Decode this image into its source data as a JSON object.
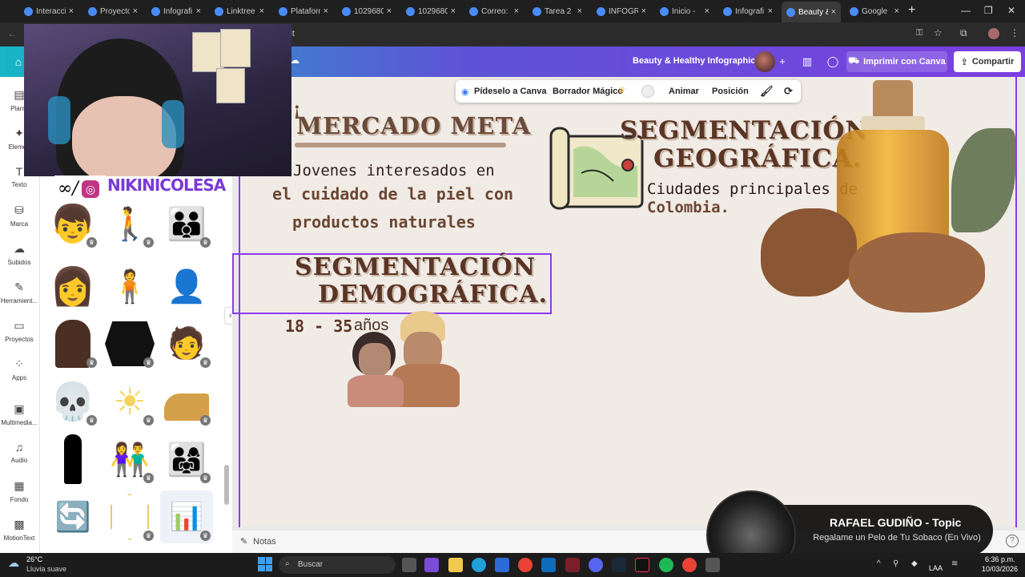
{
  "browser": {
    "tabs": [
      {
        "label": "Interacci"
      },
      {
        "label": "Proyecto"
      },
      {
        "label": "Infografi"
      },
      {
        "label": "Linktree"
      },
      {
        "label": "Plataform"
      },
      {
        "label": "1029680"
      },
      {
        "label": "1029680"
      },
      {
        "label": "Correo: "
      },
      {
        "label": "Tarea 2"
      },
      {
        "label": "INFOGR"
      },
      {
        "label": "Inicio - "
      },
      {
        "label": "Infografi"
      },
      {
        "label": "Beauty &"
      },
      {
        "label": "Google"
      }
    ],
    "url_fragment": "lit"
  },
  "canva_header": {
    "doc_title": "Beauty & Healthy Infographic",
    "print_label": "Imprimir con Canva",
    "share_label": "Compartir"
  },
  "left_rail": {
    "items": [
      {
        "label": "Plantil",
        "icon": "template-icon"
      },
      {
        "label": "Elemen",
        "icon": "elements-icon"
      },
      {
        "label": "Texto",
        "icon": "text-icon"
      },
      {
        "label": "Marca",
        "icon": "brand-icon"
      },
      {
        "label": "Subidos",
        "icon": "upload-icon"
      },
      {
        "label": "Herramient...",
        "icon": "tools-icon"
      },
      {
        "label": "Proyectos",
        "icon": "folder-icon"
      },
      {
        "label": "Apps",
        "icon": "apps-icon"
      },
      {
        "label": "Multimedia...",
        "icon": "media-icon"
      },
      {
        "label": "Audio",
        "icon": "audio-icon"
      },
      {
        "label": "Fondo",
        "icon": "background-icon"
      },
      {
        "label": "MotionText",
        "icon": "motiontext-icon"
      }
    ]
  },
  "floating_toolbar": {
    "ask_canva": "Pídeselo a Canva",
    "magic_eraser": "Borrador Mágico",
    "animate": "Animar",
    "position": "Posición"
  },
  "design": {
    "mercado_meta": "MERCADO META",
    "target_line1": "Jovenes interesados en",
    "target_line2": "el cuidado de la piel con",
    "target_line3": "productos naturales",
    "seg_geo_line1": "SEGMENTACIÓN",
    "seg_geo_line2": "GEOGRÁFICA.",
    "geo_desc_line1": "Ciudades principales de",
    "geo_desc_line2": "Colombia.",
    "seg_dem_line1": "SEGMENTACIÓN",
    "seg_dem_line2": "DEMOGRÁFICA.",
    "age_range": "18 - 35",
    "age_unit": "años"
  },
  "notes_label": "Notas",
  "webcam": {
    "tag": "NIKINICOLESA"
  },
  "now_playing": {
    "artist": "RAFAEL GUDIÑO - Topic",
    "song": "Regalame un Pelo de Tu Sobaco (En Vivo)"
  },
  "taskbar": {
    "temperature": "26°C",
    "weather": "Lluvia suave",
    "search_placeholder": "Buscar",
    "lang": "LAA",
    "time": "6:36 p.m.",
    "date": "10/03/2026"
  },
  "colors": {
    "canva_purple": "#8b3cf0",
    "canva_teal": "#17b6c6",
    "design_brown": "#5a3526",
    "page_bg": "#f1ebe6"
  }
}
